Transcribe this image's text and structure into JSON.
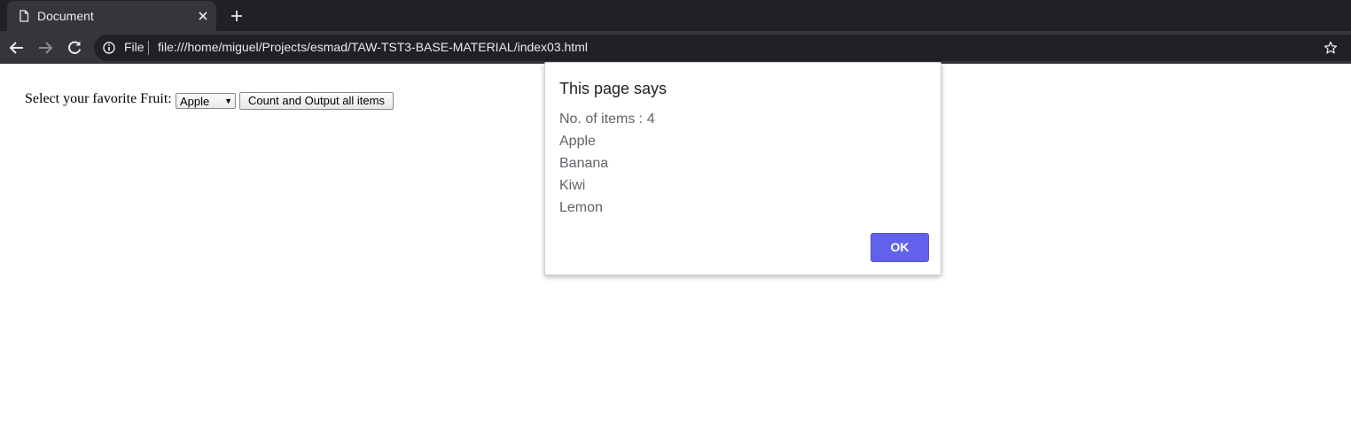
{
  "browser": {
    "tab": {
      "title": "Document"
    },
    "omnibox": {
      "scheme_label": "File",
      "url": "file:///home/miguel/Projects/esmad/TAW-TST3-BASE-MATERIAL/index03.html"
    },
    "icons": {
      "tab_page": "page-icon",
      "tab_close": "close-icon",
      "new_tab": "plus-icon",
      "back": "arrow-left-icon",
      "forward": "arrow-right-icon",
      "reload": "reload-icon",
      "info": "info-icon",
      "bookmark": "star-icon"
    }
  },
  "page": {
    "fruit_label": "Select your favorite Fruit:",
    "fruit_select_value": "Apple",
    "count_button_label": "Count and Output all items"
  },
  "dialog": {
    "title": "This page says",
    "lines": [
      "No. of items : 4",
      "Apple",
      "Banana",
      "Kiwi",
      "Lemon"
    ],
    "ok_label": "OK"
  },
  "colors": {
    "chrome_dark": "#202124",
    "chrome_tab": "#35363a",
    "ok_button": "#6161ec"
  }
}
